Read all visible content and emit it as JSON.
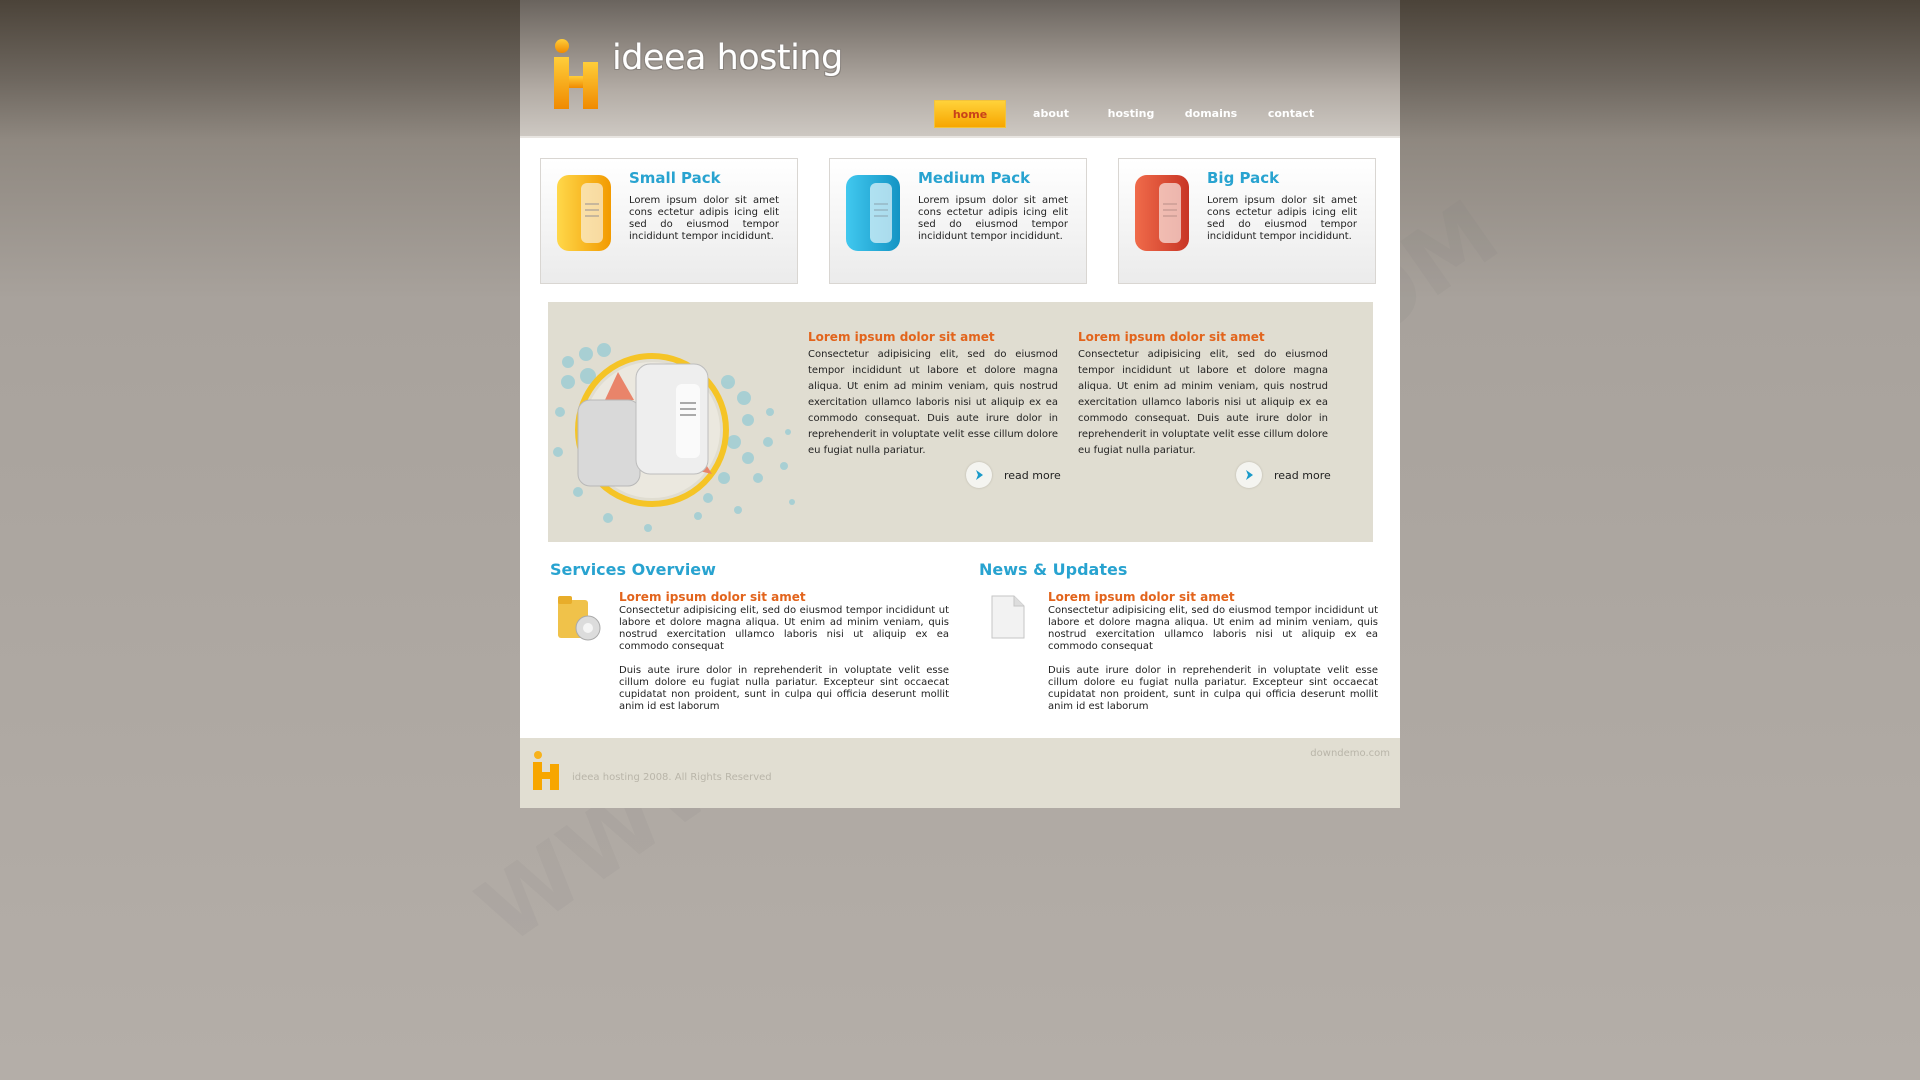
{
  "brand": {
    "logo_text": "ideea hosting",
    "colors": {
      "orange": "#f7a600",
      "blue": "#28a3d0",
      "red": "#e2641c"
    }
  },
  "nav": {
    "items": [
      {
        "label": "home",
        "active": true
      },
      {
        "label": "about",
        "active": false
      },
      {
        "label": "hosting",
        "active": false
      },
      {
        "label": "domains",
        "active": false
      },
      {
        "label": "contact",
        "active": false
      }
    ]
  },
  "packs": [
    {
      "title": "Small Pack",
      "text": "Lorem ipsum dolor sit amet cons ectetur adipis icing elit sed do eiusmod tempor incididunt tempor incididunt.",
      "icon": "orange-server-icon"
    },
    {
      "title": "Medium Pack",
      "text": "Lorem ipsum dolor sit amet cons ectetur adipis icing elit sed do eiusmod tempor incididunt tempor incididunt.",
      "icon": "blue-server-icon"
    },
    {
      "title": "Big Pack",
      "text": "Lorem ipsum dolor sit amet cons ectetur adipis icing elit sed do eiusmod tempor incididunt tempor incididunt.",
      "icon": "red-server-icon"
    }
  ],
  "banner": {
    "columns": [
      {
        "heading": "Lorem ipsum dolor sit amet",
        "text": "Consectetur adipisicing elit, sed do eiusmod tempor incididunt ut labore et dolore magna aliqua. Ut enim ad minim veniam, quis nostrud exercitation ullamco laboris nisi ut aliquip ex ea commodo consequat. Duis aute irure dolor in reprehenderit in voluptate velit esse cillum dolore eu fugiat nulla pariatur.",
        "read_more": "read more"
      },
      {
        "heading": "Lorem ipsum dolor sit amet",
        "text": "Consectetur adipisicing elit, sed do eiusmod tempor incididunt ut labore et dolore magna aliqua. Ut enim ad minim veniam, quis nostrud exercitation ullamco laboris nisi ut aliquip ex ea commodo consequat. Duis aute irure dolor in reprehenderit in voluptate velit esse cillum dolore eu fugiat nulla pariatur.",
        "read_more": "read more"
      }
    ]
  },
  "services": {
    "title": "Services Overview",
    "heading": "Lorem ipsum dolor sit amet",
    "p1": "Consectetur adipisicing elit, sed do eiusmod tempor incididunt ut labore et dolore magna aliqua. Ut enim ad minim veniam, quis nostrud exercitation ullamco laboris nisi ut aliquip ex ea commodo consequat",
    "p2": "Duis aute irure dolor in reprehenderit in voluptate velit esse cillum dolore eu fugiat nulla pariatur. Excepteur sint occaecat cupidatat non proident, sunt in culpa qui officia deserunt mollit anim id est laborum"
  },
  "news": {
    "title": "News & Updates",
    "heading": "Lorem ipsum dolor sit amet",
    "p1": "Consectetur adipisicing elit, sed do eiusmod tempor incididunt ut labore et dolore magna aliqua. Ut enim ad minim veniam, quis nostrud exercitation ullamco laboris nisi ut aliquip ex ea commodo consequat",
    "p2": "Duis aute irure dolor in reprehenderit in voluptate velit esse cillum dolore eu fugiat nulla pariatur. Excepteur sint occaecat cupidatat non proident, sunt in culpa qui officia deserunt mollit anim id est laborum"
  },
  "footer": {
    "copyright": "ideea hosting 2008. All Rights Reserved",
    "site": "downdemo.com"
  }
}
